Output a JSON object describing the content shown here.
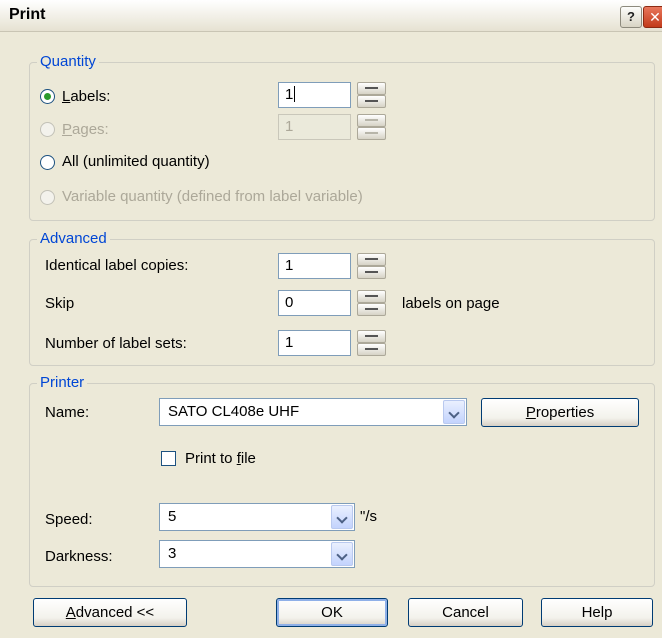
{
  "window": {
    "title": "Print",
    "help_glyph": "?",
    "close_glyph": "✕"
  },
  "quantity": {
    "legend": "Quantity",
    "labels_option": {
      "label_prefix": "",
      "label_accel": "L",
      "label_rest": "abels:",
      "checked": true,
      "value": "1"
    },
    "pages_option": {
      "label_accel": "P",
      "label_rest": "ages:",
      "enabled": false,
      "value": "1"
    },
    "all_option": {
      "label": "All (unlimited quantity)"
    },
    "variable_option": {
      "label": "Variable quantity (defined from label variable)",
      "enabled": false
    }
  },
  "advanced": {
    "legend": "Advanced",
    "identical_copies": {
      "label": "Identical label copies:",
      "value": "1"
    },
    "skip": {
      "label": "Skip",
      "value": "0",
      "suffix": "labels on page"
    },
    "label_sets": {
      "label": "Number of label sets:",
      "value": "1"
    }
  },
  "printer": {
    "legend": "Printer",
    "name_label": "Name:",
    "name_value": "SATO CL408e UHF",
    "properties_accel": "P",
    "properties_rest": "roperties",
    "print_to_file_pre": "Print to ",
    "print_to_file_accel": "f",
    "print_to_file_post": "ile",
    "speed_label": "Speed:",
    "speed_value": "5",
    "speed_unit": "\"/s",
    "darkness_label": "Darkness:",
    "darkness_value": "3"
  },
  "footer": {
    "advanced_accel": "A",
    "advanced_rest": "dvanced <<",
    "ok_label": "OK",
    "cancel_label": "Cancel",
    "help_label": "Help"
  },
  "colors": {
    "dialog_bg": "#ece9d8",
    "legend_text": "#0046d5",
    "radio_checked": "#2b9a2b",
    "disabled_text": "#aca899"
  }
}
